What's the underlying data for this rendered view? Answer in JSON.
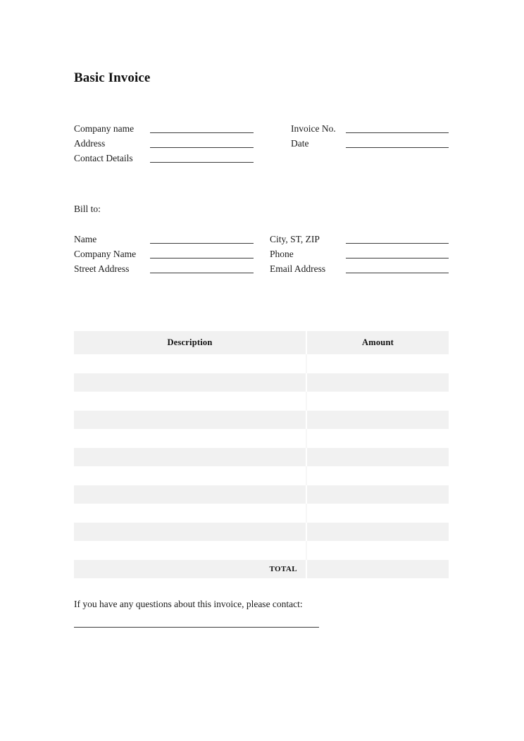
{
  "document": {
    "title": "Basic Invoice",
    "page_background": "#ffffff",
    "text_color": "#1a1a1a"
  },
  "issuer": {
    "fields": [
      {
        "label": "Company name",
        "value": ""
      },
      {
        "label": "Address",
        "value": ""
      },
      {
        "label": "Contact Details",
        "value": ""
      }
    ]
  },
  "invoice_meta": {
    "fields": [
      {
        "label": "Invoice No.",
        "value": ""
      },
      {
        "label": "Date",
        "value": ""
      }
    ]
  },
  "bill_to": {
    "heading": "Bill to:",
    "left_fields": [
      {
        "label": "Name",
        "value": ""
      },
      {
        "label": "Company Name",
        "value": ""
      },
      {
        "label": "Street Address",
        "value": ""
      }
    ],
    "right_fields": [
      {
        "label": "City, ST, ZIP",
        "value": ""
      },
      {
        "label": "Phone",
        "value": ""
      },
      {
        "label": "Email Address",
        "value": ""
      }
    ]
  },
  "items_table": {
    "columns": [
      "Description",
      "Amount"
    ],
    "header_background": "#f1f1f1",
    "shade_background": "#f1f1f1",
    "rows": [
      {
        "description": "",
        "amount": ""
      },
      {
        "description": "",
        "amount": ""
      },
      {
        "description": "",
        "amount": ""
      },
      {
        "description": "",
        "amount": ""
      },
      {
        "description": "",
        "amount": ""
      },
      {
        "description": "",
        "amount": ""
      },
      {
        "description": "",
        "amount": ""
      },
      {
        "description": "",
        "amount": ""
      },
      {
        "description": "",
        "amount": ""
      },
      {
        "description": "",
        "amount": ""
      }
    ],
    "total_label": "TOTAL",
    "total_value": ""
  },
  "footer": {
    "note": "If you have any questions about this invoice, please contact:",
    "contact_value": ""
  }
}
